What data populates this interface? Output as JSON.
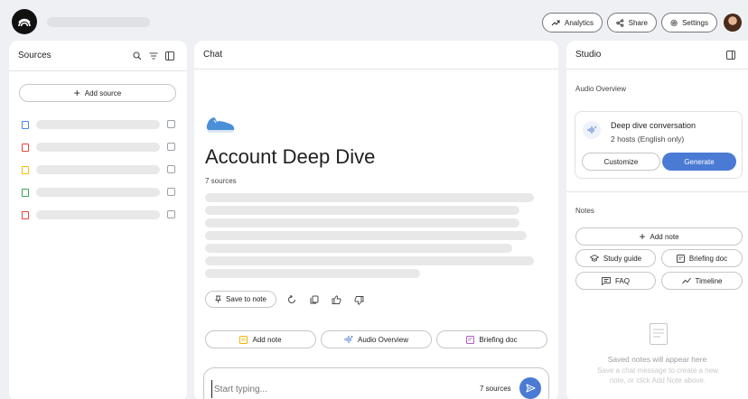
{
  "topbar": {
    "analytics_label": "Analytics",
    "share_label": "Share",
    "settings_label": "Settings"
  },
  "sources": {
    "title": "Sources",
    "add_source_label": "Add source",
    "items": [
      {
        "icon": "doc-icon",
        "color": "#4285f4"
      },
      {
        "icon": "pdf-icon",
        "color": "#ea4335"
      },
      {
        "icon": "slides-icon",
        "color": "#fbbc04"
      },
      {
        "icon": "sheets-icon",
        "color": "#34a853"
      },
      {
        "icon": "pdf-icon",
        "color": "#ea4335"
      }
    ]
  },
  "chat": {
    "title": "Chat",
    "notebook_title": "Account Deep Dive",
    "source_count": "7 sources",
    "save_to_note_label": "Save to note",
    "suggestions": {
      "add_note": "Add note",
      "audio_overview": "Audio Overview",
      "briefing_doc": "Briefing doc"
    },
    "input_placeholder": "Start typing...",
    "input_source_count": "7 sources"
  },
  "studio": {
    "title": "Studio",
    "audio_overview_heading": "Audio Overview",
    "audio_card_title": "Deep dive conversation",
    "audio_card_subtitle": "2 hosts (English only)",
    "customize_label": "Customize",
    "generate_label": "Generate",
    "notes_heading": "Notes",
    "add_note_label": "Add note",
    "study_guide_label": "Study guide",
    "briefing_doc_label": "Briefing doc",
    "faq_label": "FAQ",
    "timeline_label": "Timeline",
    "empty_title": "Saved notes will appear here",
    "empty_body": "Save a chat message to create a new note, or click Add Note above."
  },
  "colors": {
    "accent": "#4a7ad4",
    "background": "#eef0f4"
  }
}
